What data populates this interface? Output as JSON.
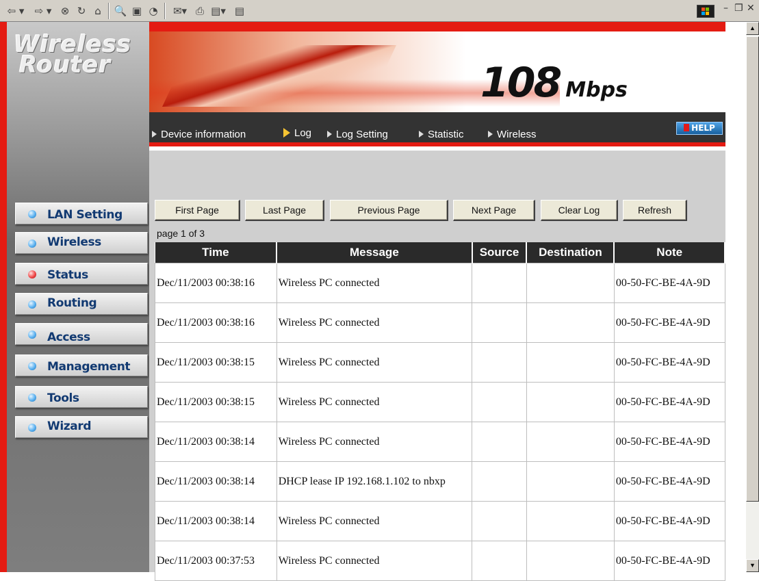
{
  "browser_toolbar": {
    "icons": [
      "back-icon",
      "forward-icon",
      "stop-icon",
      "refresh-icon",
      "home-icon",
      "search-icon",
      "favorites-icon",
      "history-icon",
      "mail-icon",
      "print-icon",
      "edit-icon",
      "discuss-icon"
    ],
    "glyphs": {
      "back": "⇦ ▾",
      "forward": "⇨ ▾",
      "stop": "⊗",
      "refresh": "↻",
      "home": "⌂",
      "search": "🔍",
      "favorites": "▣",
      "history": "◔",
      "mail": "✉▾",
      "print": "⎙",
      "edit": "▤▾",
      "discuss": "▤"
    },
    "window_controls": {
      "minimize": "–",
      "restore": "❐",
      "close": "✕"
    }
  },
  "brand": {
    "line1": "Wireless",
    "line2": "Router"
  },
  "banner": {
    "speed": "108",
    "unit": "Mbps"
  },
  "top_menu": {
    "items": [
      "Device information",
      "Log",
      "Log Setting",
      "Statistic",
      "Wireless"
    ],
    "active": "Log",
    "help_label": "HELP"
  },
  "sidebar": {
    "items": [
      "LAN Setting",
      "Wireless",
      "Status",
      "Routing",
      "Access",
      "Management",
      "Tools",
      "Wizard"
    ],
    "active": "Status"
  },
  "log_controls": {
    "buttons": [
      "First Page",
      "Last Page",
      "Previous Page",
      "Next Page",
      "Clear Log",
      "Refresh"
    ],
    "page_info": "page 1 of 3"
  },
  "log_table": {
    "columns": [
      "Time",
      "Message",
      "Source",
      "Destination",
      "Note"
    ],
    "rows": [
      {
        "time": "Dec/11/2003 00:38:16",
        "message": "Wireless PC connected",
        "source": "",
        "destination": "",
        "note": "00-50-FC-BE-4A-9D"
      },
      {
        "time": "Dec/11/2003 00:38:16",
        "message": "Wireless PC connected",
        "source": "",
        "destination": "",
        "note": "00-50-FC-BE-4A-9D"
      },
      {
        "time": "Dec/11/2003 00:38:15",
        "message": "Wireless PC connected",
        "source": "",
        "destination": "",
        "note": "00-50-FC-BE-4A-9D"
      },
      {
        "time": "Dec/11/2003 00:38:15",
        "message": "Wireless PC connected",
        "source": "",
        "destination": "",
        "note": "00-50-FC-BE-4A-9D"
      },
      {
        "time": "Dec/11/2003 00:38:14",
        "message": "Wireless PC connected",
        "source": "",
        "destination": "",
        "note": "00-50-FC-BE-4A-9D"
      },
      {
        "time": "Dec/11/2003 00:38:14",
        "message": "DHCP lease IP 192.168.1.102 to nbxp",
        "source": "",
        "destination": "",
        "note": "00-50-FC-BE-4A-9D"
      },
      {
        "time": "Dec/11/2003 00:38:14",
        "message": "Wireless PC connected",
        "source": "",
        "destination": "",
        "note": "00-50-FC-BE-4A-9D"
      },
      {
        "time": "Dec/11/2003 00:37:53",
        "message": "Wireless PC connected",
        "source": "",
        "destination": "",
        "note": "00-50-FC-BE-4A-9D"
      }
    ]
  },
  "colors": {
    "accent_red": "#e41b12",
    "menu_bg": "#333333",
    "header_bg": "#2a2a2a",
    "sidebar_text": "#123a72"
  }
}
